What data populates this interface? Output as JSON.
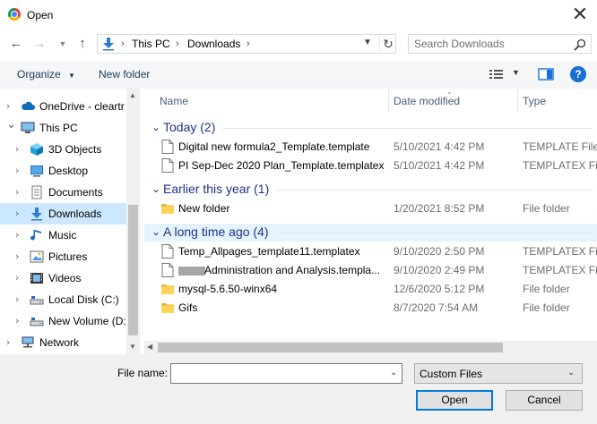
{
  "window": {
    "title": "Open",
    "close_glyph": "✕"
  },
  "nav": {
    "back_glyph": "←",
    "forward_glyph": "→",
    "recent_glyph": "⌄",
    "up_glyph": "↑",
    "breadcrumb": [
      "This PC",
      "Downloads"
    ],
    "refresh_glyph": "↻",
    "search_placeholder": "Search Downloads"
  },
  "toolbar": {
    "organize_label": "Organize",
    "new_folder_label": "New folder",
    "help_label": "?"
  },
  "sidebar": {
    "items": [
      {
        "label": "OneDrive - cleartr",
        "icon": "cloud-icon",
        "level": 0,
        "selected": false
      },
      {
        "label": "This PC",
        "icon": "computer-icon",
        "level": 0,
        "selected": false,
        "expanded": true
      },
      {
        "label": "3D Objects",
        "icon": "cube-icon",
        "level": 1,
        "selected": false
      },
      {
        "label": "Desktop",
        "icon": "desktop-icon",
        "level": 1,
        "selected": false
      },
      {
        "label": "Documents",
        "icon": "document-icon",
        "level": 1,
        "selected": false
      },
      {
        "label": "Downloads",
        "icon": "download-icon",
        "level": 1,
        "selected": true
      },
      {
        "label": "Music",
        "icon": "music-icon",
        "level": 1,
        "selected": false
      },
      {
        "label": "Pictures",
        "icon": "picture-icon",
        "level": 1,
        "selected": false
      },
      {
        "label": "Videos",
        "icon": "video-icon",
        "level": 1,
        "selected": false
      },
      {
        "label": "Local Disk (C:)",
        "icon": "drive-icon",
        "level": 1,
        "selected": false
      },
      {
        "label": "New Volume (D:",
        "icon": "drive-icon",
        "level": 1,
        "selected": false
      },
      {
        "label": "Network",
        "icon": "network-icon",
        "level": 0,
        "selected": false
      }
    ]
  },
  "columns": {
    "name": "Name",
    "date": "Date modified",
    "type": "Type"
  },
  "groups": [
    {
      "label": "Today (2)",
      "highlighted": false,
      "files": [
        {
          "name": "Digital new formula2_Template.template",
          "date": "5/10/2021 4:42 PM",
          "type": "TEMPLATE File",
          "kind": "file"
        },
        {
          "name": "PI Sep-Dec 2020 Plan_Template.templatex",
          "date": "5/10/2021 4:42 PM",
          "type": "TEMPLATEX File",
          "kind": "file"
        }
      ]
    },
    {
      "label": "Earlier this year (1)",
      "highlighted": false,
      "files": [
        {
          "name": "New folder",
          "date": "1/20/2021 8:52 PM",
          "type": "File folder",
          "kind": "folder"
        }
      ]
    },
    {
      "label": "A long time ago (4)",
      "highlighted": true,
      "files": [
        {
          "name": "Temp_Allpages_template11.templatex",
          "date": "9/10/2020 2:50 PM",
          "type": "TEMPLATEX File",
          "kind": "file"
        },
        {
          "name": "Administration and Analysis.templa...",
          "date": "9/10/2020 2:49 PM",
          "type": "TEMPLATEX File",
          "kind": "file",
          "redacted_prefix": true
        },
        {
          "name": "mysql-5.6.50-winx64",
          "date": "12/6/2020 5:12 PM",
          "type": "File folder",
          "kind": "folder"
        },
        {
          "name": "Gifs",
          "date": "8/7/2020 7:54 AM",
          "type": "File folder",
          "kind": "folder"
        }
      ]
    }
  ],
  "bottom": {
    "file_name_label": "File name:",
    "file_name_value": "",
    "filter_value": "Custom Files",
    "open_label": "Open",
    "cancel_label": "Cancel"
  },
  "colors": {
    "accent": "#0078d7",
    "selection": "#cce8ff",
    "group_text": "#1e3287",
    "folder": "#ffd357"
  }
}
